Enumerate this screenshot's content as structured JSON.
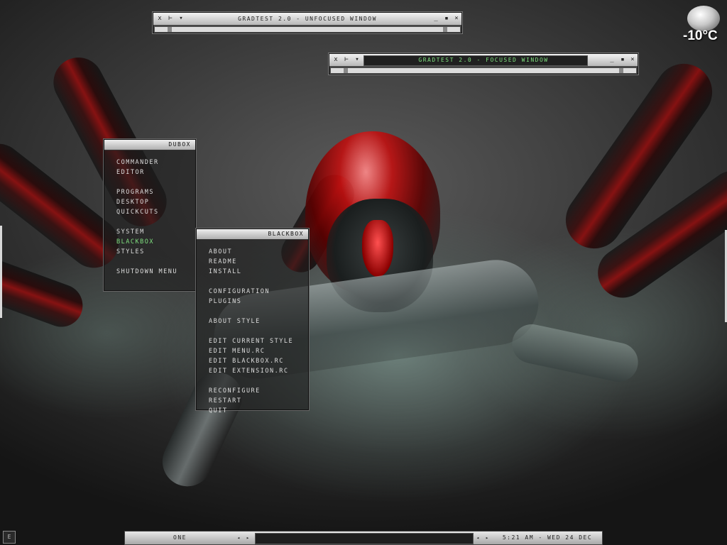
{
  "windows": {
    "unfocused": {
      "title": "GRADTEST 2.0 - UNFOCUSED WINDOW",
      "btn_menu": "x",
      "btn_pin": "⊢",
      "btn_down": "▾",
      "btn_min": "_",
      "btn_max": "▪",
      "btn_close": "×"
    },
    "focused": {
      "title": "GRADTEST 2.0 - FOCUSED WINDOW",
      "btn_menu": "x",
      "btn_pin": "⊢",
      "btn_down": "▾",
      "btn_min": "_",
      "btn_max": "▪",
      "btn_close": "×"
    }
  },
  "dubox_menu": {
    "title": "DUBOX",
    "items": [
      "COMMANDER",
      "EDITOR",
      "",
      "PROGRAMS",
      "DESKTOP",
      "QUICKCUTS",
      "",
      "SYSTEM",
      "BLACKBOX",
      "STYLES",
      "",
      "SHUTDOWN MENU"
    ],
    "active_item": "BLACKBOX",
    "active_color": "#7fe07f"
  },
  "blackbox_menu": {
    "title": "BLACKBOX",
    "items": [
      "ABOUT",
      "README",
      "INSTALL",
      "",
      "CONFIGURATION",
      "PLUGINS",
      "",
      "ABOUT STYLE",
      "",
      "EDIT CURRENT STYLE",
      "EDIT MENU.RC",
      "EDIT BLACKBOX.RC",
      "EDIT EXTENSION.RC",
      "",
      "RECONFIGURE",
      "RESTART",
      "QUIT"
    ]
  },
  "weather": {
    "temperature": "-10°C",
    "icon": "cloud-icon"
  },
  "toolbar": {
    "workspace": "ONE",
    "prev_arrow": "◂",
    "next_arrow": "▸",
    "clock": "5:21 AM - WED 24 DEC"
  },
  "tray": {
    "left_button": "E"
  }
}
